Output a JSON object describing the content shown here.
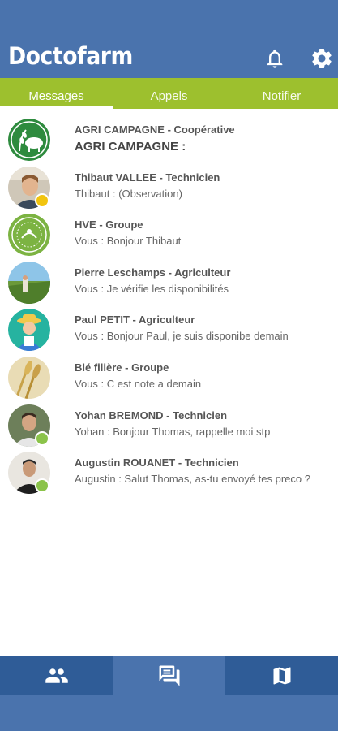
{
  "app": {
    "title": "Doctofarm"
  },
  "header": {
    "icons": [
      "bell-icon",
      "gear-icon"
    ]
  },
  "tabs": [
    {
      "label": "Messages",
      "active": true
    },
    {
      "label": "Appels",
      "active": false
    },
    {
      "label": "Notifier",
      "active": false
    }
  ],
  "conversations": [
    {
      "name": "AGRI CAMPAGNE  - Coopérative",
      "last": "AGRI CAMPAGNE :",
      "avatar": "cooperative-logo",
      "status": null
    },
    {
      "name": "Thibaut VALLEE - Technicien",
      "last": "Thibaut : (Observation)",
      "avatar": "person-photo",
      "status": "away"
    },
    {
      "name": "HVE - Groupe",
      "last": "Vous :   Bonjour Thibaut",
      "avatar": "hve-logo",
      "status": null
    },
    {
      "name": "Pierre Leschamps - Agriculteur",
      "last": "Vous : Je vérifie les disponibilités",
      "avatar": "field-photo",
      "status": null
    },
    {
      "name": "Paul PETIT - Agriculteur",
      "last": "Vous : Bonjour Paul, je suis disponibe demain",
      "avatar": "farmer-illustration",
      "status": null
    },
    {
      "name": "Blé filière  - Groupe",
      "last": "Vous :  C est note a demain",
      "avatar": "wheat-photo",
      "status": null
    },
    {
      "name": "Yohan BREMOND - Technicien",
      "last": "Yohan : Bonjour Thomas, rappelle moi stp",
      "avatar": "person-photo",
      "status": "online"
    },
    {
      "name": "Augustin ROUANET - Technicien",
      "last": "Augustin : Salut Thomas, as-tu envoyé tes preco ?",
      "avatar": "person-photo",
      "status": "online"
    }
  ],
  "bottom_nav": [
    {
      "icon": "contacts-icon",
      "active": false
    },
    {
      "icon": "chat-icon",
      "active": true
    },
    {
      "icon": "map-icon",
      "active": false
    }
  ],
  "colors": {
    "header": "#4a73ad",
    "tabs": "#9dc02e",
    "bottom_nav": "#2f5c97",
    "status_away": "#f1c40f",
    "status_online": "#8bc34a"
  }
}
